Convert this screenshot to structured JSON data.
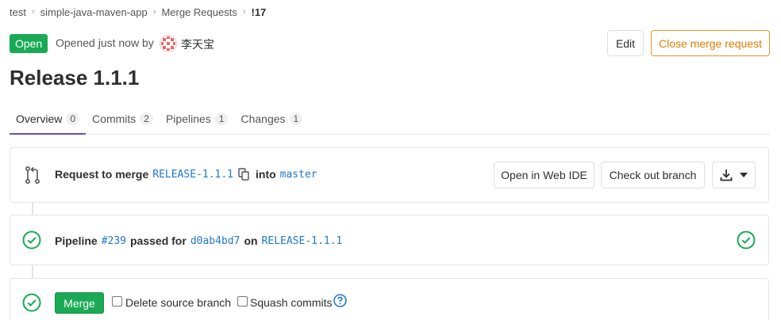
{
  "breadcrumb": {
    "items": [
      "test",
      "simple-java-maven-app",
      "Merge Requests",
      "!17"
    ],
    "separator": ">"
  },
  "header": {
    "status": "Open",
    "opened_text": "Opened just now by",
    "author": "李天宝",
    "edit_label": "Edit",
    "close_label": "Close merge request"
  },
  "title": "Release 1.1.1",
  "tabs": [
    {
      "label": "Overview",
      "count": "0",
      "active": true
    },
    {
      "label": "Commits",
      "count": "2",
      "active": false
    },
    {
      "label": "Pipelines",
      "count": "1",
      "active": false
    },
    {
      "label": "Changes",
      "count": "1",
      "active": false
    }
  ],
  "merge_request": {
    "prefix": "Request to merge",
    "source_branch": "RELEASE-1.1.1",
    "into": "into",
    "target_branch": "master",
    "web_ide_label": "Open in Web IDE",
    "checkout_label": "Check out branch",
    "icons": {
      "merge_request": "merge-request-icon",
      "copy": "copy-icon",
      "download": "download-icon",
      "caret": "chevron-down-icon"
    }
  },
  "pipeline": {
    "label": "Pipeline",
    "id": "#239",
    "status_text": "passed for",
    "commit": "d0ab4bd7",
    "on": "on",
    "branch": "RELEASE-1.1.1",
    "status_color": "#1aaa55"
  },
  "merge": {
    "button_label": "Merge",
    "delete_source_label": "Delete source branch",
    "delete_source_checked": false,
    "squash_label": "Squash commits",
    "squash_checked": false,
    "help_icon": "question-circle-icon"
  },
  "colors": {
    "success": "#1aaa55",
    "warning": "#de7e00",
    "link": "#1f78d1",
    "tab_active": "#6b4fbb"
  }
}
